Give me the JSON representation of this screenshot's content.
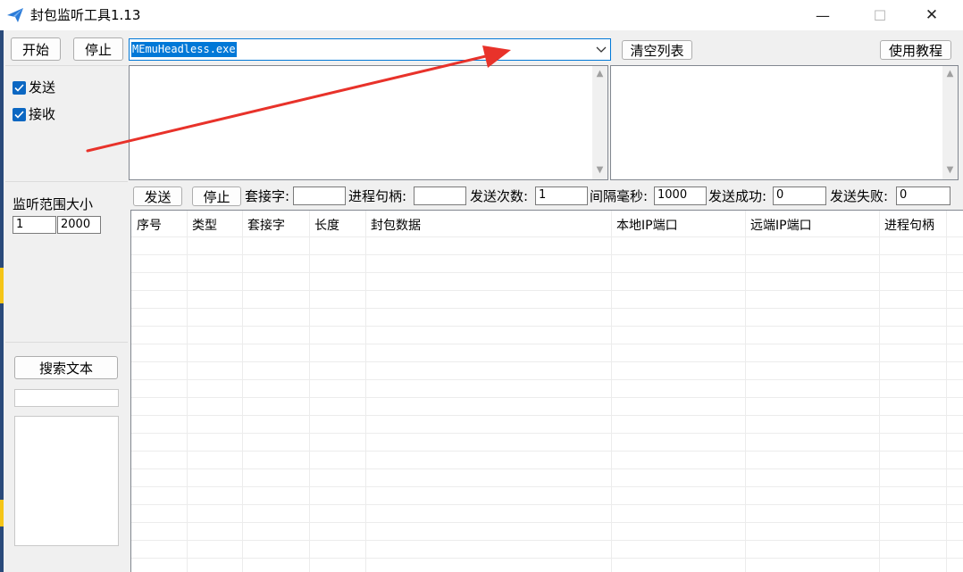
{
  "window": {
    "title": "封包监听工具1.13",
    "controls": {
      "minimize": "—",
      "maximize": "☐",
      "close": "✕"
    }
  },
  "toolbar": {
    "start_label": "开始",
    "stop_label": "停止",
    "process_selected": "MEmuHeadless.exe",
    "clear_list_label": "清空列表",
    "tutorial_label": "使用教程"
  },
  "filters": {
    "send_label": "发送",
    "send_checked": true,
    "recv_label": "接收",
    "recv_checked": true
  },
  "range": {
    "label": "监听范围大小",
    "min": "1",
    "max": "2000"
  },
  "search": {
    "button_label": "搜索文本",
    "input_value": ""
  },
  "send_bar": {
    "send_label": "发送",
    "stop_label": "停止",
    "socket_label": "套接字:",
    "socket_value": "",
    "handle_label": "进程句柄:",
    "handle_value": "",
    "count_label": "发送次数:",
    "count_value": "1",
    "interval_label": "间隔毫秒:",
    "interval_value": "1000",
    "success_label": "发送成功:",
    "success_value": "0",
    "fail_label": "发送失败:",
    "fail_value": "0"
  },
  "table": {
    "columns": [
      "序号",
      "类型",
      "套接字",
      "长度",
      "封包数据",
      "本地IP端口",
      "远端IP端口",
      "进程句柄"
    ],
    "rows": []
  },
  "colors": {
    "accent": "#0b67c2",
    "arrow": "#e8322a",
    "background": "#f0f0f0"
  }
}
